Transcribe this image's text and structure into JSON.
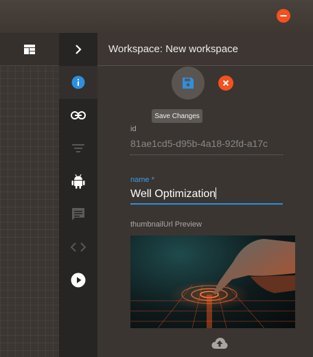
{
  "topbar": {
    "close_icon": "minus-circle-icon",
    "accent": "#f4511e"
  },
  "canvas": {
    "icon": "dashboard-icon"
  },
  "rail": {
    "toggle_icon": "chevron-right-icon",
    "items": [
      {
        "icon": "info-icon",
        "active": true
      },
      {
        "icon": "link-icon"
      },
      {
        "icon": "filter-icon",
        "disabled": true
      },
      {
        "icon": "android-icon"
      },
      {
        "icon": "comment-icon"
      },
      {
        "icon": "code-icon",
        "disabled": true
      },
      {
        "icon": "play-circle-icon"
      }
    ]
  },
  "panel": {
    "title": "Workspace: New workspace",
    "save_icon": "save-icon",
    "cancel_icon": "cancel-icon",
    "tooltip": "Save Changes",
    "fields": {
      "id": {
        "label": "id",
        "value": "81ae1cd5-d95b-4a18-92fd-a17c"
      },
      "name": {
        "label": "name *",
        "value": "Well Optimization"
      },
      "thumbnail": {
        "label": "thumbnailUrl Preview",
        "upload_icon": "cloud-upload-icon"
      }
    }
  },
  "colors": {
    "accent_blue": "#2f8fe0",
    "accent_orange": "#f4511e"
  }
}
